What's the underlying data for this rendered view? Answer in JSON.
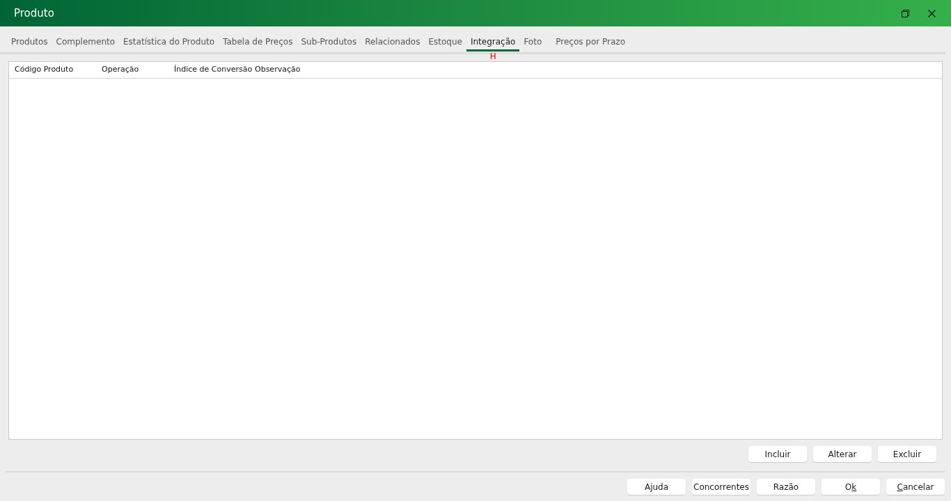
{
  "window": {
    "title": "Produto"
  },
  "tabs": [
    {
      "label": "Produtos",
      "selected": false
    },
    {
      "label": "Complemento",
      "selected": false
    },
    {
      "label": "Estatística do Produto",
      "selected": false
    },
    {
      "label": "Tabela de Preços",
      "selected": false
    },
    {
      "label": "Sub-Produtos",
      "selected": false
    },
    {
      "label": "Relacionados",
      "selected": false
    },
    {
      "label": "Estoque",
      "selected": false
    },
    {
      "label": "Integração",
      "selected": true,
      "keytip": "H"
    },
    {
      "label": "Foto",
      "selected": false
    },
    {
      "label": "Preços por Prazo",
      "selected": false
    }
  ],
  "table": {
    "columns": [
      "Código Produto",
      "Operação",
      "Índice de Conversão",
      "Observação"
    ]
  },
  "table_buttons": [
    {
      "label": "Incluir"
    },
    {
      "label": "Alterar"
    },
    {
      "label": "Excluir"
    }
  ],
  "footer_buttons": [
    {
      "before": "Ajuda"
    },
    {
      "before": "Concorrentes"
    },
    {
      "before": "Razão"
    },
    {
      "before": "O",
      "underlined": "k"
    },
    {
      "underlined": "C",
      "after": "ancelar"
    }
  ]
}
